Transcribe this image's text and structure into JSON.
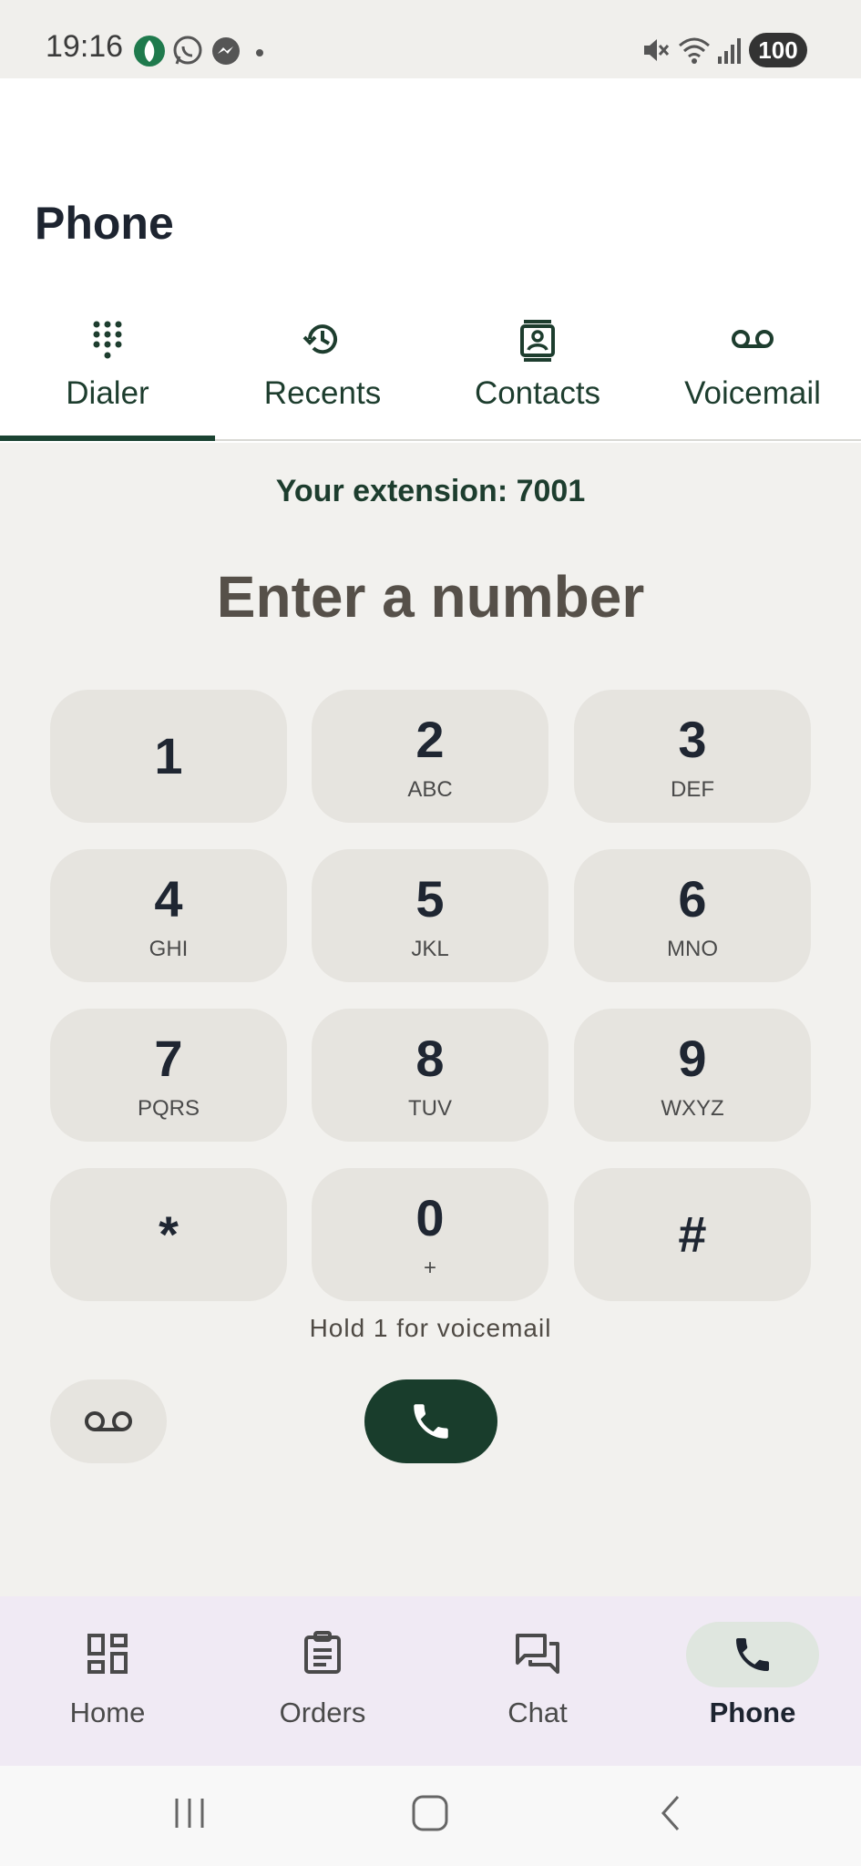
{
  "status_bar": {
    "time": "19:16",
    "battery": "100",
    "left_icons": [
      "leaf-app-icon",
      "whatsapp-icon",
      "messenger-icon",
      "dot-icon"
    ],
    "right_icons": [
      "mute-icon",
      "wifi-icon",
      "signal-icon"
    ]
  },
  "header": {
    "title": "Phone",
    "tabs": [
      {
        "label": "Dialer",
        "icon": "dialpad-icon",
        "active": true
      },
      {
        "label": "Recents",
        "icon": "history-icon"
      },
      {
        "label": "Contacts",
        "icon": "contacts-icon"
      },
      {
        "label": "Voicemail",
        "icon": "voicemail-icon"
      }
    ]
  },
  "dialer": {
    "extension": "Your extension: 7001",
    "display_placeholder": "Enter a number",
    "keys": [
      {
        "digit": "1",
        "letters": ""
      },
      {
        "digit": "2",
        "letters": "ABC"
      },
      {
        "digit": "3",
        "letters": "DEF"
      },
      {
        "digit": "4",
        "letters": "GHI"
      },
      {
        "digit": "5",
        "letters": "JKL"
      },
      {
        "digit": "6",
        "letters": "MNO"
      },
      {
        "digit": "7",
        "letters": "PQRS"
      },
      {
        "digit": "8",
        "letters": "TUV"
      },
      {
        "digit": "9",
        "letters": "WXYZ"
      },
      {
        "digit": "*",
        "letters": ""
      },
      {
        "digit": "0",
        "letters": "+"
      },
      {
        "digit": "#",
        "letters": ""
      }
    ],
    "hint": "Hold 1 for voicemail"
  },
  "bottom_nav": {
    "items": [
      {
        "label": "Home",
        "icon": "dashboard-icon"
      },
      {
        "label": "Orders",
        "icon": "clipboard-icon"
      },
      {
        "label": "Chat",
        "icon": "chat-icon"
      },
      {
        "label": "Phone",
        "icon": "phone-icon",
        "active": true
      }
    ]
  },
  "colors": {
    "accent": "#1b4332",
    "call_button": "#193d2c",
    "key_bg": "#e6e4df",
    "nav_bg": "#f0eaf4"
  }
}
